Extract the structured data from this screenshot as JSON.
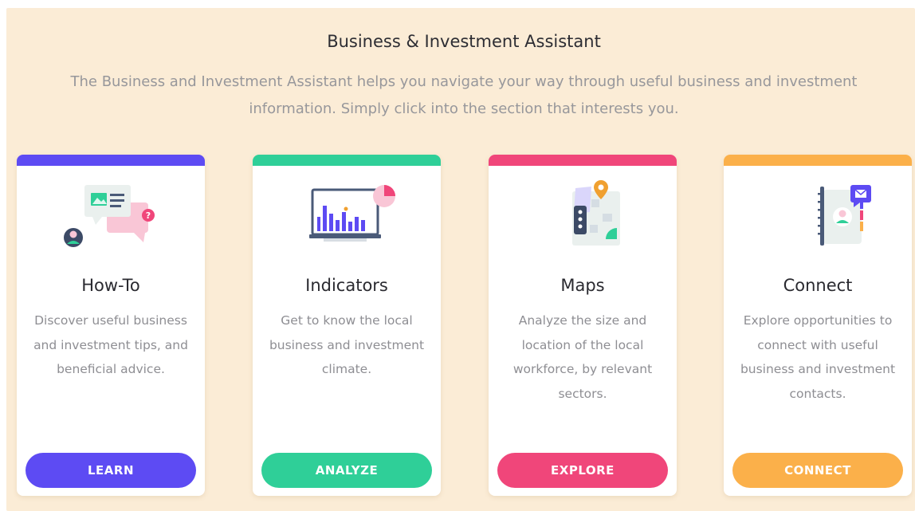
{
  "header": {
    "title": "Business & Investment Assistant",
    "description": "The Business and Investment Assistant helps you navigate your way through useful business and investment information. Simply click into the section that interests you."
  },
  "colors": {
    "background": "#fbecd6",
    "purple": "#5d4bf3",
    "green": "#2fcf98",
    "pink": "#f0467a",
    "orange": "#fbb04a"
  },
  "cards": [
    {
      "title": "How-To",
      "description": "Discover useful business and investment tips, and beneficial advice.",
      "button": "LEARN",
      "icon": "chat-bubbles-icon"
    },
    {
      "title": "Indicators",
      "description": "Get to know the local business and investment climate.",
      "button": "ANALYZE",
      "icon": "bar-chart-monitor-icon"
    },
    {
      "title": "Maps",
      "description": "Analyze the size and location of the local workforce, by relevant sectors.",
      "button": "EXPLORE",
      "icon": "map-pin-icon"
    },
    {
      "title": "Connect",
      "description": "Explore opportunities to connect with useful business and investment contacts.",
      "button": "CONNECT",
      "icon": "contact-book-icon"
    }
  ]
}
